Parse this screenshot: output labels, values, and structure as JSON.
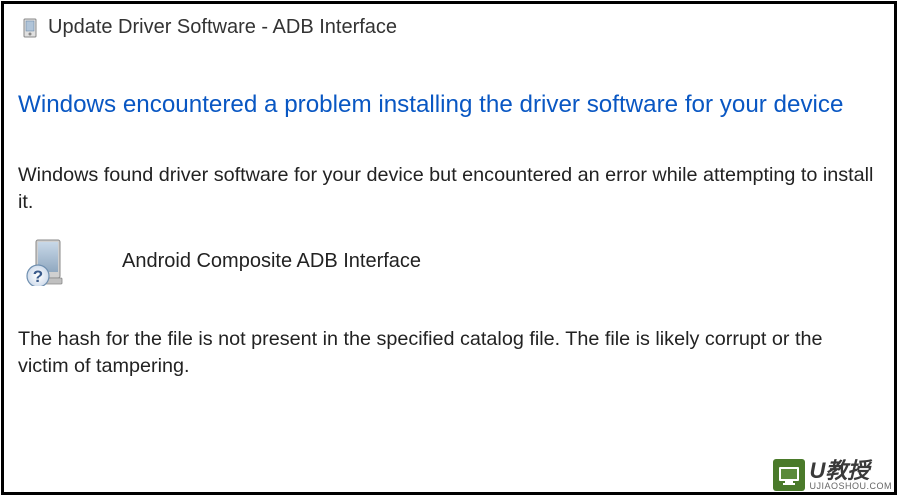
{
  "dialog": {
    "title": "Update Driver Software - ADB Interface",
    "heading": "Windows encountered a problem installing the driver software for your device",
    "sub_message": "Windows found driver software for your device but encountered an error while attempting to install it.",
    "device_name": "Android Composite ADB Interface",
    "error_detail": "The hash for the file is not present in the specified catalog file. The file is likely corrupt or the victim of tampering."
  },
  "watermark": {
    "badge_letter": "U",
    "brand": "U教授",
    "domain": "UJIAOSHOU.COM"
  }
}
